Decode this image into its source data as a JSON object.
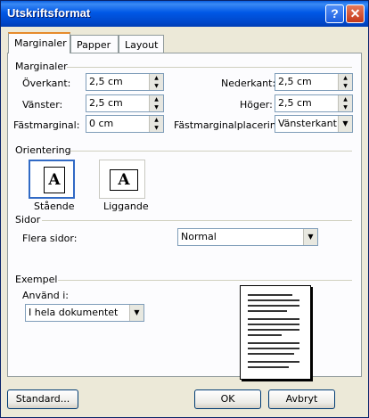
{
  "window": {
    "title": "Utskriftsformat"
  },
  "titlebar": {
    "help_glyph": "?",
    "close_glyph": "✕"
  },
  "tabs": [
    {
      "label": "Marginaler",
      "active": true
    },
    {
      "label": "Papper",
      "active": false
    },
    {
      "label": "Layout",
      "active": false
    }
  ],
  "margins": {
    "heading": "Marginaler",
    "top_label": "Överkant:",
    "top_value": "2,5 cm",
    "bottom_label": "Nederkant:",
    "bottom_value": "2,5 cm",
    "left_label": "Vänster:",
    "left_value": "2,5 cm",
    "right_label": "Höger:",
    "right_value": "2,5 cm",
    "gutter_label": "Fästmarginal:",
    "gutter_value": "0 cm",
    "gutter_pos_label": "Fästmarginalplacering:",
    "gutter_pos_value": "Vänsterkant"
  },
  "orientation": {
    "heading": "Orientering",
    "portrait_label": "Stående",
    "landscape_label": "Liggande",
    "icon_letter": "A",
    "selected": "portrait"
  },
  "pages": {
    "heading": "Sidor",
    "multiple_label": "Flera sidor:",
    "multiple_value": "Normal"
  },
  "preview": {
    "heading": "Exempel",
    "apply_label": "Använd i:",
    "apply_value": "I hela dokumentet"
  },
  "buttons": {
    "default": "Standard...",
    "ok": "OK",
    "cancel": "Avbryt"
  },
  "colors": {
    "title_bar": "#0054e3",
    "dialog_bg": "#ece9d8",
    "active_tab_accent": "#e68b2c",
    "close_button": "#c4381a"
  }
}
